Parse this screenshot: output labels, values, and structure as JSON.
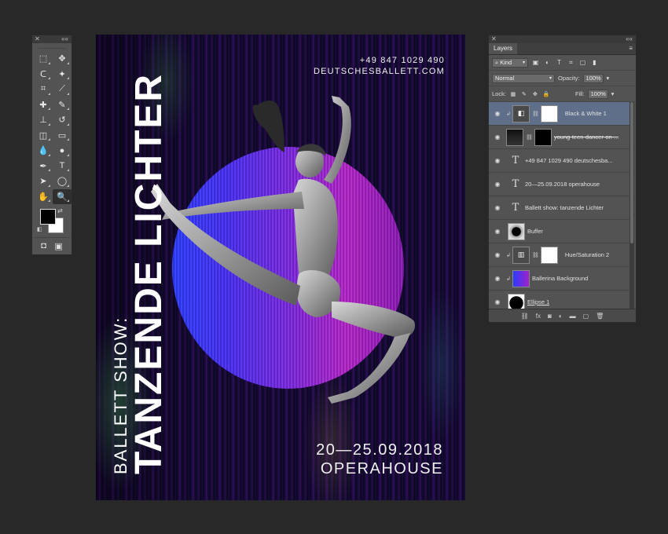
{
  "tools_panel": {
    "close": "✕",
    "collapse": "««",
    "tools": [
      {
        "name": "rect-marquee",
        "glyph": "⬚"
      },
      {
        "name": "move",
        "glyph": "✥"
      },
      {
        "name": "lasso",
        "glyph": "ᑕ"
      },
      {
        "name": "magic-wand",
        "glyph": "✦"
      },
      {
        "name": "crop",
        "glyph": "⌗"
      },
      {
        "name": "eyedropper",
        "glyph": "⟋"
      },
      {
        "name": "healing",
        "glyph": "✚"
      },
      {
        "name": "brush",
        "glyph": "✎"
      },
      {
        "name": "clone-stamp",
        "glyph": "⊥"
      },
      {
        "name": "history-brush",
        "glyph": "↺"
      },
      {
        "name": "eraser",
        "glyph": "◫"
      },
      {
        "name": "gradient",
        "glyph": "▭"
      },
      {
        "name": "blur",
        "glyph": "💧"
      },
      {
        "name": "dodge",
        "glyph": "●"
      },
      {
        "name": "pen",
        "glyph": "✒"
      },
      {
        "name": "type",
        "glyph": "T"
      },
      {
        "name": "path-selection",
        "glyph": "➤"
      },
      {
        "name": "ellipse",
        "glyph": "◯"
      },
      {
        "name": "hand",
        "glyph": "✋"
      },
      {
        "name": "zoom",
        "glyph": "🔍"
      }
    ],
    "swap_glyph": "⇄",
    "default_glyph": "◧",
    "quickmask_glyph": "◘",
    "screenmode_glyph": "▣"
  },
  "poster": {
    "phone": "+49 847 1029 490",
    "website": "DEUTSCHESBALLETT.COM",
    "title_small": "BALLETT SHOW:",
    "title_big": "TANZENDE LICHTER",
    "dates": "20—25.09.2018",
    "venue": "OPERAHOUSE"
  },
  "layers_panel": {
    "close": "✕",
    "collapse": "««",
    "tab": "Layers",
    "menu": "≡",
    "filter_kind": "Kind",
    "blend_mode": "Normal",
    "opacity_label": "Opacity:",
    "opacity_value": "100%",
    "lock_label": "Lock:",
    "fill_label": "Fill:",
    "fill_value": "100%",
    "layers": [
      {
        "name": "Black & White 1"
      },
      {
        "name": "young-teen-dancer-on-..."
      },
      {
        "name": "+49 847 1029 490 deutschesba..."
      },
      {
        "name": "20—25.09.2018 operahouse"
      },
      {
        "name": "Ballett show: tanzende Lichter"
      },
      {
        "name": "Buffer"
      },
      {
        "name": "Hue/Saturation 2"
      },
      {
        "name": "Ballerina Background"
      },
      {
        "name": "Ellipse 1"
      }
    ],
    "footer_icons": [
      "⛓",
      "fx",
      "◙",
      "◐",
      "▬",
      "▢",
      "🗑"
    ]
  }
}
